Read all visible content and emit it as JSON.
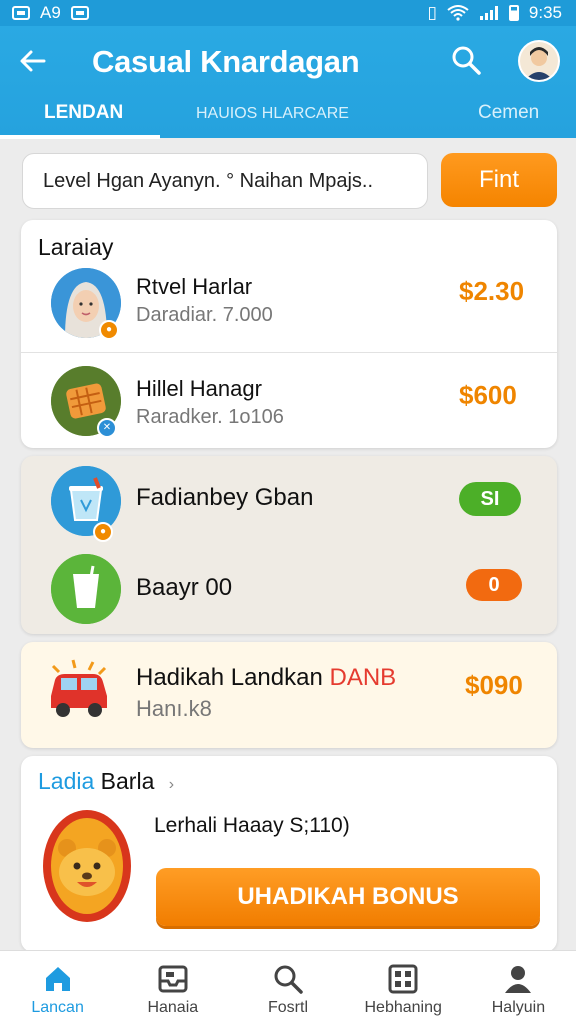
{
  "status_bar": {
    "time_left": "A9",
    "time_right": "9:35"
  },
  "app_bar": {
    "title": "Casual Knardagan",
    "tabs": [
      {
        "label": "LENDAN",
        "active": true
      },
      {
        "label": "HAUIOS HLARCARE",
        "active": false
      },
      {
        "label": "Cemen",
        "active": false
      }
    ]
  },
  "search": {
    "value": "Level Hgan Ayanyn. ° Naihan Mpajs..",
    "button_label": "Fint"
  },
  "section_list": {
    "title": "Laraiay",
    "items": [
      {
        "name": "Rtvel Harlar",
        "sub": "Daradiar. 7.000",
        "price": "$2.30",
        "icon": "woman-avatar-icon"
      },
      {
        "name": "Hillel Hanagr",
        "sub": "Raradker. 1o106",
        "price": "$600",
        "icon": "toast-food-icon"
      }
    ]
  },
  "section_tasks": {
    "items": [
      {
        "name": "Fadianbey Gban",
        "badge": "SI",
        "badge_color": "#4caf28",
        "icon": "trash-bin-icon"
      },
      {
        "name": "Baayr 00",
        "badge": "0",
        "badge_color": "#f26a10",
        "icon": "cup-icon"
      }
    ]
  },
  "promo": {
    "title": "Hadikah Landkan",
    "highlight": "DANB",
    "sub": "Hanı.k8",
    "price": "$090",
    "icon": "red-car-icon"
  },
  "bonus": {
    "title": "Ladia",
    "title_rest": "Barla",
    "text": "Lerhali Haaay S;110)",
    "button_label": "UHADIKAH BONUS",
    "icon": "bear-mascot-icon"
  },
  "bottom_nav": [
    {
      "label": "Lancan",
      "icon": "home-icon",
      "active": true
    },
    {
      "label": "Hanaia",
      "icon": "inbox-icon",
      "active": false
    },
    {
      "label": "Fosrtl",
      "icon": "search-icon",
      "active": false
    },
    {
      "label": "Hebhaning",
      "icon": "grid-icon",
      "active": false
    },
    {
      "label": "Halyuin",
      "icon": "person-icon",
      "active": false
    }
  ],
  "colors": {
    "primary": "#25a2de",
    "accent": "#f58400"
  }
}
